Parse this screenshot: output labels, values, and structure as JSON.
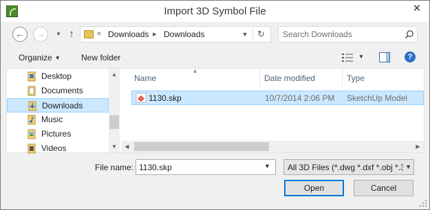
{
  "window": {
    "title": "Import 3D Symbol File",
    "close_glyph": "✕"
  },
  "address": {
    "overflow_chevron": "«",
    "segments": [
      "Downloads",
      "Downloads"
    ],
    "separator": "▸"
  },
  "search": {
    "placeholder": "Search Downloads"
  },
  "toolbar": {
    "organize_label": "Organize",
    "new_folder_label": "New folder"
  },
  "nav_pane": {
    "items": [
      {
        "label": "Desktop",
        "icon": "desktop-folder-icon",
        "selected": false
      },
      {
        "label": "Documents",
        "icon": "documents-folder-icon",
        "selected": false
      },
      {
        "label": "Downloads",
        "icon": "downloads-folder-icon",
        "selected": true
      },
      {
        "label": "Music",
        "icon": "music-folder-icon",
        "selected": false
      },
      {
        "label": "Pictures",
        "icon": "pictures-folder-icon",
        "selected": false
      },
      {
        "label": "Videos",
        "icon": "videos-folder-icon",
        "selected": false
      }
    ]
  },
  "file_list": {
    "columns": [
      "Name",
      "Date modified",
      "Type"
    ],
    "rows": [
      {
        "name": "1130.skp",
        "date_modified": "10/7/2014 2:06 PM",
        "type": "SketchUp Model",
        "icon": "sketchup-file-icon",
        "selected": true
      }
    ]
  },
  "footer": {
    "file_name_label": "File name:",
    "file_name_value": "1130.skp",
    "file_type_value": "All 3D Files (*.dwg *.dxf *.obj *.3",
    "open_label": "Open",
    "cancel_label": "Cancel"
  },
  "colors": {
    "selection_fill": "#cce8ff",
    "selection_border": "#99d1ff",
    "accent": "#0078d7"
  }
}
